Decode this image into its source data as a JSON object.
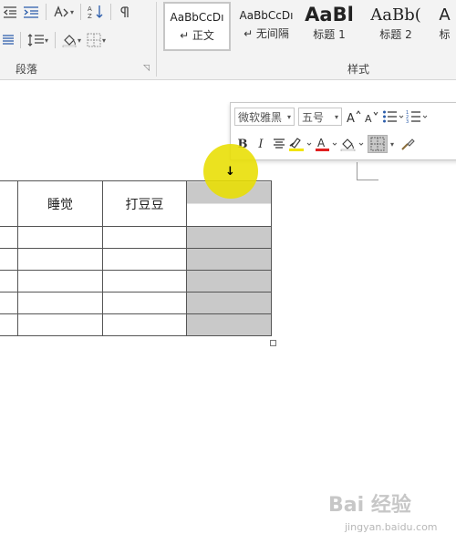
{
  "ribbon": {
    "paragraph_group_label": "段落",
    "styles_group_label": "样式",
    "styles": [
      {
        "preview": "AaBbCcDı",
        "name": "↵ 正文",
        "selected": true
      },
      {
        "preview": "AaBbCcDı",
        "name": "↵ 无间隔",
        "selected": false
      },
      {
        "preview": "AaBl",
        "name": "标题 1",
        "selected": false
      },
      {
        "preview": "AaBb(",
        "name": "标题 2",
        "selected": false
      },
      {
        "preview": "A",
        "name": "标",
        "selected": false
      }
    ]
  },
  "mini_toolbar": {
    "font_name": "微软雅黑",
    "font_size": "五号",
    "font_color": "#e02020",
    "highlight_color": "#f2e400"
  },
  "table": {
    "headers": [
      "",
      "睡觉",
      "打豆豆",
      ""
    ],
    "rows": [
      [
        "",
        "",
        "",
        ""
      ],
      [
        "",
        "",
        "",
        ""
      ],
      [
        "",
        "",
        "",
        ""
      ],
      [
        "",
        "",
        "",
        ""
      ],
      [
        "",
        "",
        "",
        ""
      ]
    ],
    "shading_color": "#c9c9c9"
  },
  "watermark": {
    "logo": "Bai 经验",
    "url": "jingyan.baidu.com"
  }
}
